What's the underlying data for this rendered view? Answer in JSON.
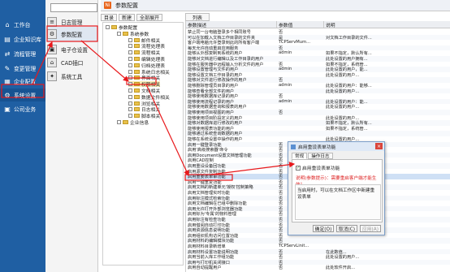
{
  "sidebar": {
    "items": [
      {
        "label": "工作台",
        "icon": "home-icon",
        "glyph": "⌂"
      },
      {
        "label": "企业知识库",
        "icon": "book-icon",
        "glyph": "▤"
      },
      {
        "label": "流程管理",
        "icon": "flow-icon",
        "glyph": "⇄"
      },
      {
        "label": "变更管理",
        "icon": "edit-icon",
        "glyph": "✎"
      },
      {
        "label": "企业配置",
        "icon": "building-icon",
        "glyph": "▦"
      },
      {
        "label": "系统设置",
        "icon": "gear-icon",
        "glyph": "⚙"
      },
      {
        "label": "公司业务",
        "icon": "grid-icon",
        "glyph": "▣"
      }
    ]
  },
  "col2": {
    "search_placeholder": "",
    "items": [
      {
        "label": "日志管理",
        "glyph": "≡"
      },
      {
        "label": "参数配置",
        "glyph": "⚙"
      },
      {
        "label": "电子仓设置",
        "glyph": "▣"
      },
      {
        "label": "CAD插口",
        "glyph": "⌂"
      },
      {
        "label": "系统工具",
        "glyph": "✦"
      }
    ]
  },
  "titlebar": {
    "logo": "Ni",
    "title": "参数配置"
  },
  "toolbar": {
    "btn1": "目录",
    "btn2": "新建",
    "btn3": "全部展开"
  },
  "list_tab": "列表",
  "tree": [
    {
      "label": "参数配置",
      "depth": 0
    },
    {
      "label": "系统参数",
      "depth": 1
    },
    {
      "label": "邮件相关",
      "depth": 2
    },
    {
      "label": "流程处理表",
      "depth": 2
    },
    {
      "label": "流程相关",
      "depth": 2
    },
    {
      "label": "编辑处理表",
      "depth": 2
    },
    {
      "label": "归档处理表",
      "depth": 2
    },
    {
      "label": "系统日志相关",
      "depth": 2
    },
    {
      "label": "界面相关",
      "depth": 2
    },
    {
      "label": "权限相关",
      "depth": 2,
      "selected": true
    },
    {
      "label": "文档相关",
      "depth": 2
    },
    {
      "label": "数据文件相关",
      "depth": 2
    },
    {
      "label": "浏览相关",
      "depth": 2
    },
    {
      "label": "日志相关",
      "depth": 2
    },
    {
      "label": "脚本相关",
      "depth": 2
    },
    {
      "label": "企业信息",
      "depth": 1
    }
  ],
  "list": {
    "headers": [
      "参数描述",
      "参数值",
      "说明"
    ],
    "rows": [
      [
        "禁止同一台电脑登录多个相同账号",
        "否",
        ""
      ],
      [
        "可以在加载入文档工作目录的文件夹",
        "是",
        "对文档工作目录的文件..."
      ],
      [
        "客户端电脑允许登录到此的所有客户端",
        "TCPServMum...",
        ""
      ],
      [
        "每天允许自动重启应用服务",
        "否",
        ""
      ],
      [
        "能够从外部复制到系统的用户",
        "admin",
        "如果不指定，默认所有..."
      ],
      [
        "能够对文档进行编辑以及工作目录的用户",
        "",
        "此处设置的用户拥有..."
      ],
      [
        "能够在服务器中远程输入分析文件的用户",
        "否",
        "如果不指定，系统管..."
      ],
      [
        "能够设置管理与文件的用户",
        "admin",
        "此处设置的用户，能..."
      ],
      [
        "能够设置文档工作目录的用户",
        "",
        "此处设置的用户..."
      ],
      [
        "能够对文件进行修改操作的用户",
        "否",
        ""
      ],
      [
        "能够删除管理员目录的用户",
        "admin",
        "此处设置的用户：能够..."
      ],
      [
        "能够查看全部文件的用户",
        "",
        "此处设置的用户..."
      ],
      [
        "能够使用数据库记录的用户",
        "否",
        ""
      ],
      [
        "能够使用流程记录的用户",
        "admin",
        "此处设置的用户：能..."
      ],
      [
        "能够使用数据查询和报表的用户",
        "",
        "此处设置的用户..."
      ],
      [
        "能够使用项目视图的用户",
        "否",
        ""
      ],
      [
        "能够使用项目阶段定义的用户",
        "",
        "此处设置的用户..."
      ],
      [
        "能够对数据库进行修改的用户",
        "",
        "如果不指定，默认所有..."
      ],
      [
        "能够使用报表功能的用户",
        "",
        "如果不指定，系统管..."
      ],
      [
        "能够通过系统查询数据的用户",
        "",
        ""
      ],
      [
        "能够在系统设置中操作的用户",
        "",
        "此处设置的用户..."
      ],
      [
        "启用一键登录功能",
        "否",
        ""
      ],
      [
        "启用'高级搜索器'命令",
        "否",
        ""
      ],
      [
        "启用Document设置文档管理功能",
        "否",
        ""
      ],
      [
        "启用CAD控制",
        "否",
        ""
      ],
      [
        "启用重设设备回功能",
        "否",
        ""
      ],
      [
        "启用源文件复制功能",
        "否",
        ""
      ],
      [
        "启用重要表单审功能",
        "否",
        ""
      ],
      [
        "启用一键重复功能",
        "否",
        ""
      ],
      [
        "启用文档的新建单元'授权'控制策略",
        "否",
        ""
      ],
      [
        "启用文档管理实时功能",
        "否",
        ""
      ],
      [
        "启用标注模式检索功能",
        "否",
        ""
      ],
      [
        "启用文档编辑在已组中删除功能",
        "否",
        ""
      ],
      [
        "启用允许打开外部浏览器功能",
        "否",
        ""
      ],
      [
        "启用标为'专属'的物料管理",
        "否",
        ""
      ],
      [
        "启用标注有检查功能",
        "否",
        ""
      ],
      [
        "启用借阅自动打印功能",
        "否",
        ""
      ],
      [
        "启用资源信息说明功能",
        "否",
        ""
      ],
      [
        "启用组织机构访问位置功能",
        "否",
        ""
      ],
      [
        "启用材料的编辑模块功能",
        "否",
        ""
      ],
      [
        "启用材料目录新增单",
        "TCPServLinit...",
        ""
      ],
      [
        "启用材料设置功能说明功能",
        "否",
        "在此数值..."
      ],
      [
        "启用当前入库工作组功能",
        "否",
        "此处设置的用户..."
      ],
      [
        "启用与打印机关闭接口",
        "否",
        ""
      ],
      [
        "启用自动提醒用户",
        "否",
        "此处软件开启..."
      ]
    ]
  },
  "dialog": {
    "title": "启用重设表单功能",
    "close": "×",
    "tabs": [
      "常规",
      "操作日志"
    ],
    "checkbox_label": "启用重设表单功能",
    "checkbox_mark": "✓",
    "note": "说明(参数提示)：需要重启客户端才能生效！",
    "description": "当启用时，可以在文档工作区中新建重设表单",
    "ok": "确定(O)",
    "cancel": "取消(C)",
    "apply": "应用(A)"
  }
}
